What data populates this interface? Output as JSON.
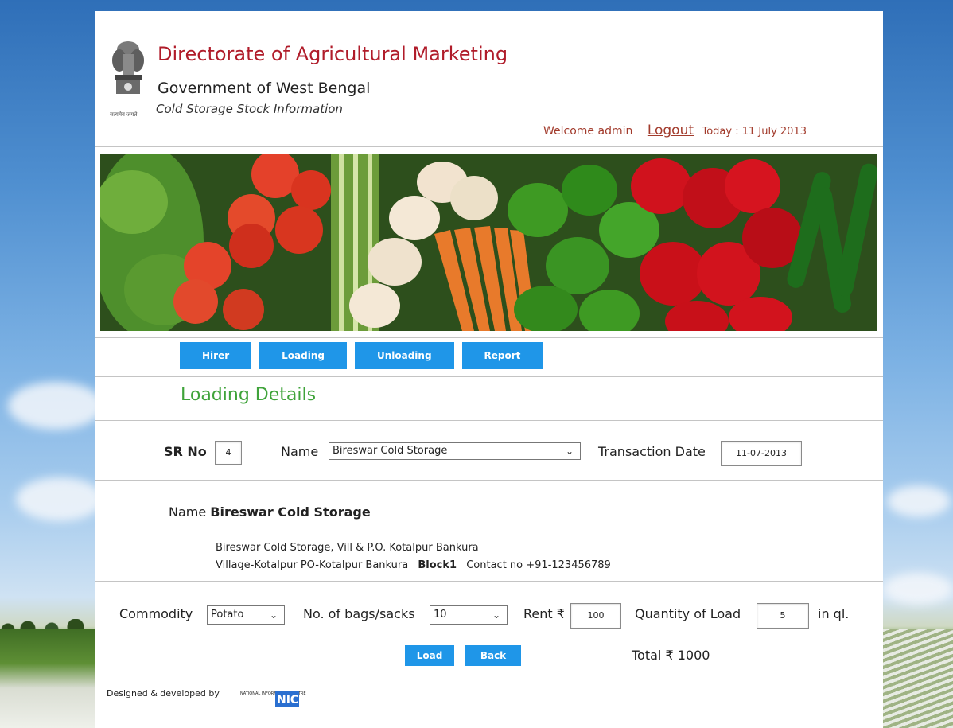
{
  "header": {
    "title": "Directorate of Agricultural Marketing",
    "subtitle": "Government of West Bengal",
    "tagline": "Cold Storage Stock Information",
    "welcome": "Welcome admin",
    "logout": "Logout",
    "today": "Today : 11 July 2013"
  },
  "nav": [
    {
      "label": "Hirer"
    },
    {
      "label": "Loading"
    },
    {
      "label": "Unloading"
    },
    {
      "label": "Report"
    }
  ],
  "section_title": "Loading Details",
  "form": {
    "sr_label": "SR No",
    "sr_value": "4",
    "name_label": "Name",
    "name_value": "Bireswar Cold Storage",
    "date_label": "Transaction Date",
    "date_value": "11-07-2013"
  },
  "details": {
    "name_label": "Name",
    "name_value": "Bireswar Cold Storage",
    "address_line1": "Bireswar Cold Storage, Vill & P.O. Kotalpur Bankura",
    "address_line2_a": "Village-Kotalpur  PO-Kotalpur  Bankura",
    "block": "Block1",
    "contact": "Contact no +91-123456789"
  },
  "load": {
    "commodity_label": "Commodity",
    "commodity_value": "Potato",
    "bags_label": "No. of bags/sacks",
    "bags_value": "10",
    "rent_label": "Rent ₹",
    "rent_value": "100",
    "qty_label": "Quantity of Load",
    "qty_value": "5",
    "unit": "in ql.",
    "load_button": "Load",
    "back_button": "Back",
    "total": "Total ₹ 1000"
  },
  "footer": {
    "text": "Designed & developed by",
    "nic_small": "NATIONAL INFORMATICS CENTRE",
    "nic_logo": "NIC"
  },
  "colors": {
    "title_red": "#b01c2a",
    "button_blue": "#1f96e8",
    "section_green": "#3fa33a"
  }
}
